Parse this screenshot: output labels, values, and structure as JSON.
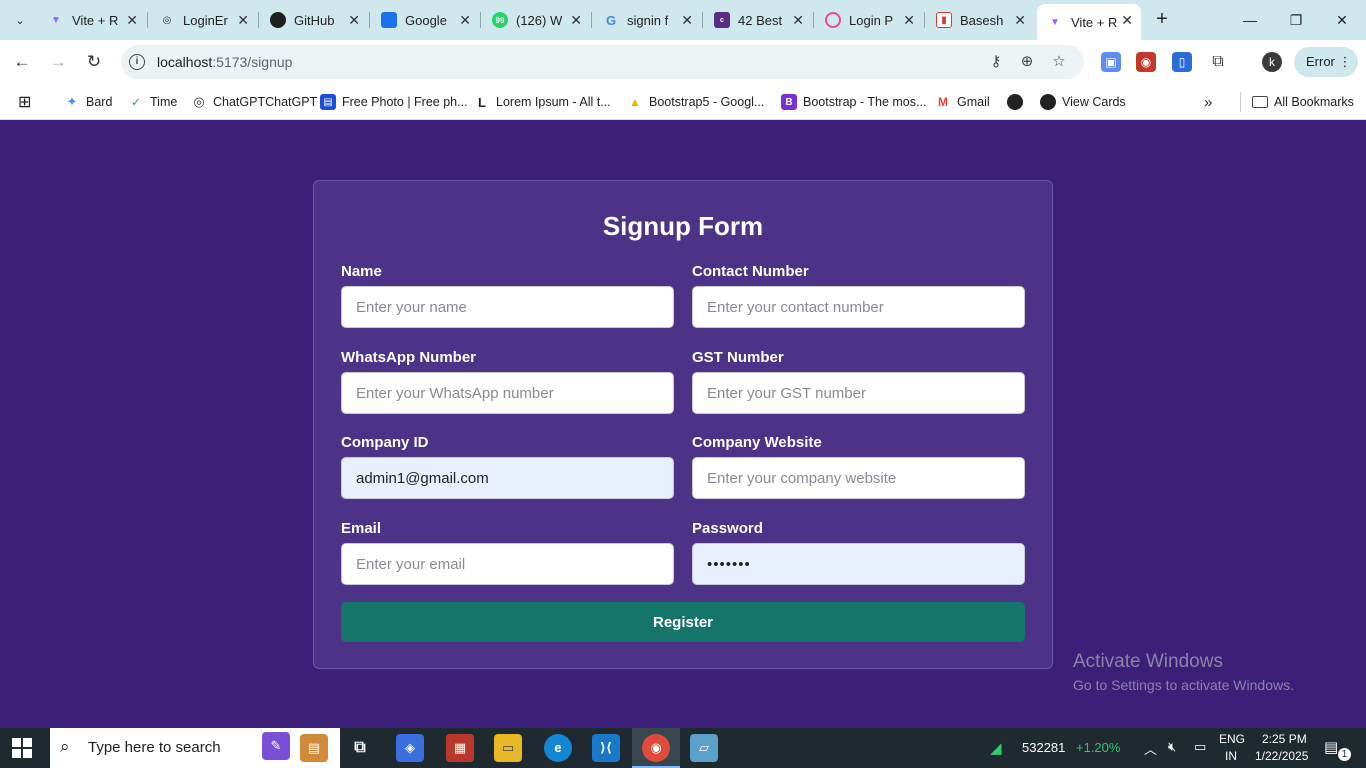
{
  "browser": {
    "tabs": [
      {
        "title": "Vite + R",
        "favicon_color": "#a05cff",
        "favicon": "V"
      },
      {
        "title": "LoginEr",
        "favicon_color": "#333333",
        "favicon": "◎"
      },
      {
        "title": "GitHub",
        "favicon_color": "#1f1f1f",
        "favicon": "●"
      },
      {
        "title": "Google",
        "favicon_color": "#1a73e8",
        "favicon": "▲"
      },
      {
        "title": "(126) W",
        "favicon_color": "#25d366",
        "favicon": "99"
      },
      {
        "title": "signin f",
        "favicon_color": "#4285f4",
        "favicon": "G"
      },
      {
        "title": "42 Best",
        "favicon_color": "#5a2d82",
        "favicon": "c"
      },
      {
        "title": "Login P",
        "favicon_color": "#ea4c89",
        "favicon": "◉"
      },
      {
        "title": "Basesh",
        "favicon_color": "#d33b3b",
        "favicon": "▮"
      },
      {
        "title": "Vite + R",
        "favicon_color": "#a05cff",
        "favicon": "V"
      }
    ],
    "address": {
      "host": "localhost",
      "path": ":5173/signup"
    },
    "profile_initial": "k",
    "error_label": "Error",
    "bookmarks": [
      {
        "label": "Bard",
        "color": "#4c8df6",
        "icon": "✦"
      },
      {
        "label": "Time",
        "color": "#2fa36b",
        "icon": "✓"
      },
      {
        "label": "ChatGPTChatGPT",
        "color": "#333333",
        "icon": "◎"
      },
      {
        "label": "Free Photo | Free ph...",
        "color": "#1a4fd6",
        "icon": "▤"
      },
      {
        "label": "Lorem Ipsum - All t...",
        "color": "#ffffff",
        "icon": "L"
      },
      {
        "label": "Bootstrap5 - Googl...",
        "color": "#f4b400",
        "icon": "▲"
      },
      {
        "label": "Bootstrap - The mos...",
        "color": "#7b2fd6",
        "icon": "B"
      },
      {
        "label": "Gmail",
        "color": "#ea4335",
        "icon": "M"
      },
      {
        "label": "",
        "color": "#222222",
        "icon": "◍"
      },
      {
        "label": "View Cards",
        "color": "#222222",
        "icon": "◍"
      }
    ],
    "all_bookmarks": "All Bookmarks"
  },
  "form": {
    "title": "Signup Form",
    "fields": {
      "name": {
        "label": "Name",
        "placeholder": "Enter your name",
        "value": ""
      },
      "contact": {
        "label": "Contact Number",
        "placeholder": "Enter your contact number",
        "value": ""
      },
      "whatsapp": {
        "label": "WhatsApp Number",
        "placeholder": "Enter your WhatsApp number",
        "value": ""
      },
      "gst": {
        "label": "GST Number",
        "placeholder": "Enter your GST number",
        "value": ""
      },
      "company_id": {
        "label": "Company ID",
        "placeholder": "",
        "value": "admin1@gmail.com"
      },
      "website": {
        "label": "Company Website",
        "placeholder": "Enter your company website",
        "value": ""
      },
      "email": {
        "label": "Email",
        "placeholder": "Enter your email",
        "value": ""
      },
      "password": {
        "label": "Password",
        "placeholder": "",
        "value": "•••••••"
      }
    },
    "submit_label": "Register"
  },
  "watermark": {
    "line1": "Activate Windows",
    "line2": "Go to Settings to activate Windows."
  },
  "taskbar": {
    "search_placeholder": "Type here to search",
    "stock_value": "532281",
    "stock_change": "+1.20%",
    "lang_1": "ENG",
    "lang_2": "IN",
    "time": "2:25 PM",
    "date": "1/22/2025",
    "notification_count": "1"
  }
}
